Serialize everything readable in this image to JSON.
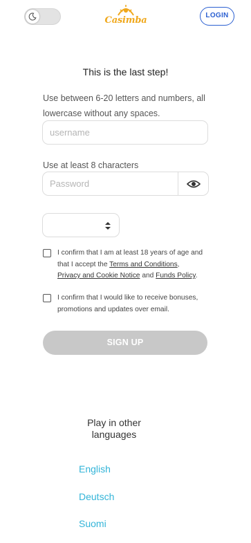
{
  "header": {
    "theme_toggle_icon": "moon-icon",
    "logo_text": "Casimba",
    "login_label": "LOGIN",
    "accent_color": "#2a5fd1",
    "logo_color": "#f0a81c"
  },
  "form": {
    "step_title": "This is the last step!",
    "username_hint": "Use between 6-20 letters and numbers, all lowercase without any spaces.",
    "username_placeholder": "username",
    "username_value": "",
    "password_hint": "Use at least 8 characters",
    "password_placeholder": "Password",
    "password_value": "",
    "show_password_icon": "eye-icon",
    "select_value": "",
    "consent_age": {
      "prefix": "I confirm that I am at least 18 years of age and that I accept the ",
      "terms_link": "Terms and Conditions",
      "sep": ",",
      "privacy_link": "Privacy and Cookie Notice",
      "and": " and ",
      "funds_link": "Funds Policy",
      "suffix": "."
    },
    "consent_marketing": "I confirm that I would like to receive bonuses, promotions and updates over email.",
    "signup_label": "SIGN UP",
    "signup_disabled_color": "#c8c8c8"
  },
  "languages": {
    "title": "Play in other languages",
    "items": [
      "English",
      "Deutsch",
      "Suomi"
    ],
    "link_color": "#32b4d8"
  }
}
